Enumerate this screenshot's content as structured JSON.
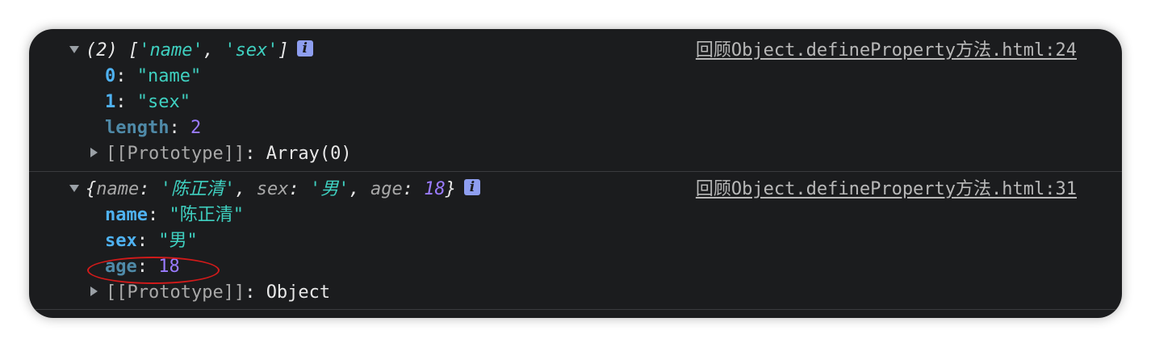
{
  "colors": {
    "panel_bg": "#1b1c1e",
    "string": "#3fd0c0",
    "number": "#9a7bff",
    "property_key": "#4fb2f2",
    "info_icon": "#8e9ef0",
    "annotation": "#d21a1a"
  },
  "entries": [
    {
      "summary": {
        "count": "(2)",
        "open": "[",
        "items": [
          "'name'",
          "'sex'"
        ],
        "sep": ", ",
        "close": "]"
      },
      "info_icon": "i",
      "source": "回顾Object.defineProperty方法.html:24",
      "properties": [
        {
          "key": "0",
          "colon": ": ",
          "value": "\"name\""
        },
        {
          "key": "1",
          "colon": ": ",
          "value": "\"sex\""
        },
        {
          "key": "length",
          "colon": ": ",
          "value": "2"
        }
      ],
      "prototype": {
        "label": "[[Prototype]]",
        "colon": ": ",
        "value": "Array(0)"
      }
    },
    {
      "summary": {
        "open": "{",
        "k1": "name",
        "v1": "'陈正清'",
        "k2": "sex",
        "v2": "'男'",
        "k3": "age",
        "v3": "18",
        "colon": ": ",
        "sep": ", ",
        "close": "}"
      },
      "info_icon": "i",
      "source": "回顾Object.defineProperty方法.html:31",
      "properties": [
        {
          "key": "name",
          "colon": ": ",
          "value": "\"陈正清\""
        },
        {
          "key": "sex",
          "colon": ": ",
          "value": "\"男\""
        },
        {
          "key": "age",
          "colon": ": ",
          "value": "18"
        }
      ],
      "prototype": {
        "label": "[[Prototype]]",
        "colon": ": ",
        "value": "Object"
      }
    }
  ]
}
